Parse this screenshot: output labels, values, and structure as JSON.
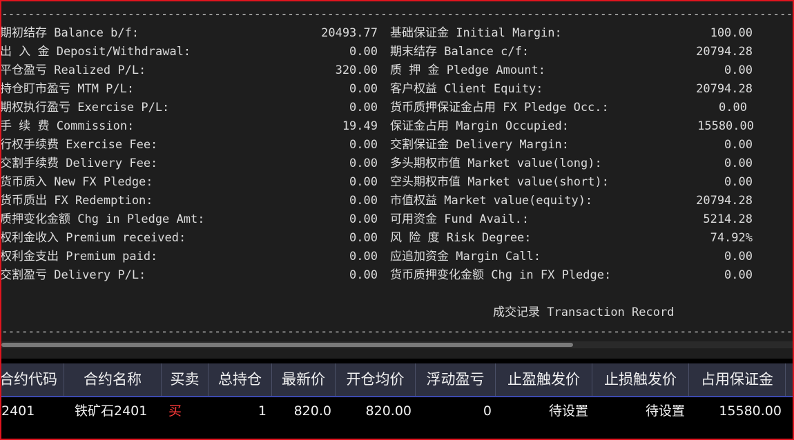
{
  "separator": "----------------------------------------------------------------------------------------------------------------------------------",
  "summary": {
    "left": [
      {
        "label": "期初结存 Balance b/f:",
        "value": "20493.77"
      },
      {
        "label": "出 入 金 Deposit/Withdrawal:",
        "value": "0.00"
      },
      {
        "label": "平仓盈亏 Realized P/L:",
        "value": "320.00"
      },
      {
        "label": "持仓盯市盈亏 MTM P/L:",
        "value": "0.00"
      },
      {
        "label": "期权执行盈亏 Exercise P/L:",
        "value": "0.00"
      },
      {
        "label": "手 续 费 Commission:",
        "value": "19.49"
      },
      {
        "label": "行权手续费 Exercise Fee:",
        "value": "0.00"
      },
      {
        "label": "交割手续费 Delivery Fee:",
        "value": "0.00"
      },
      {
        "label": "货币质入 New FX Pledge:",
        "value": "0.00"
      },
      {
        "label": "货币质出 FX Redemption:",
        "value": "0.00"
      },
      {
        "label": "质押变化金额 Chg in Pledge Amt:",
        "value": "0.00"
      },
      {
        "label": "权利金收入 Premium received:",
        "value": "0.00"
      },
      {
        "label": "权利金支出 Premium paid:",
        "value": "0.00"
      },
      {
        "label": "交割盈亏 Delivery P/L:",
        "value": "0.00"
      }
    ],
    "right": [
      {
        "label": "基础保证金 Initial Margin:",
        "value": "100.00"
      },
      {
        "label": "期末结存 Balance c/f:",
        "value": "20794.28"
      },
      {
        "label": "质 押 金 Pledge Amount:",
        "value": "0.00"
      },
      {
        "label": "客户权益 Client Equity:",
        "value": "20794.28"
      },
      {
        "label": "货币质押保证金占用 FX Pledge Occ.:",
        "value": "0.00"
      },
      {
        "label": "保证金占用 Margin Occupied:",
        "value": "15580.00"
      },
      {
        "label": "交割保证金 Delivery Margin:",
        "value": "0.00"
      },
      {
        "label": "多头期权市值 Market value(long):",
        "value": "0.00"
      },
      {
        "label": "空头期权市值 Market value(short):",
        "value": "0.00"
      },
      {
        "label": "市值权益 Market value(equity):",
        "value": "20794.28"
      },
      {
        "label": "可用资金 Fund Avail.:",
        "value": "5214.28"
      },
      {
        "label": "风 险 度 Risk Degree:",
        "value": "74.92%"
      },
      {
        "label": "应追加资金 Margin Call:",
        "value": "0.00"
      },
      {
        "label": "货币质押变化金额 Chg in FX Pledge:",
        "value": "0.00"
      }
    ]
  },
  "transaction_record_title": "成交记录 Transaction Record",
  "positions": {
    "headers": [
      "合约代码",
      "合约名称",
      "买卖",
      "总持仓",
      "最新价",
      "开仓均价",
      "浮动盈亏",
      "止盈触发价",
      "止损触发价",
      "占用保证金"
    ],
    "rows": [
      {
        "code": "2401",
        "name": "铁矿石2401",
        "side": "买",
        "total": "1",
        "last": "820.0",
        "avg_open": "820.00",
        "float_pl": "0",
        "tp_trigger": "待设置",
        "sl_trigger": "待设置",
        "margin": "15580.00"
      }
    ]
  },
  "colors": {
    "buy": "#ff3a3a",
    "header_bg": "#2d3040",
    "border": "#e0141e"
  }
}
